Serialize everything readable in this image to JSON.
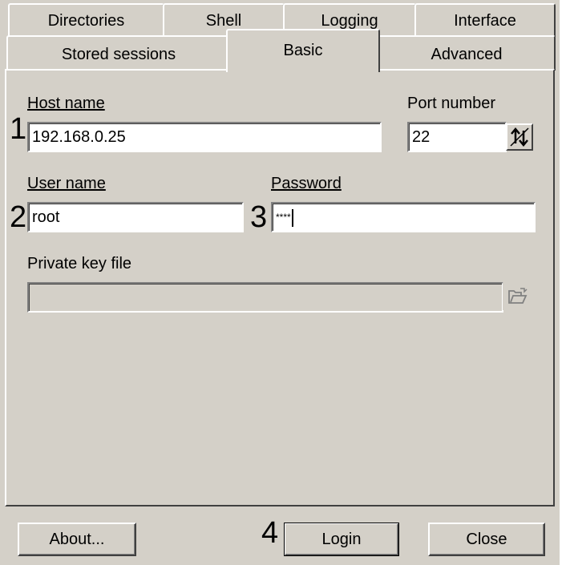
{
  "tabs": {
    "row1": [
      "Directories",
      "Shell",
      "Logging",
      "Interface"
    ],
    "row2": [
      "Stored sessions",
      "Basic",
      "Advanced"
    ],
    "active": "Basic"
  },
  "basic": {
    "host_label": "Host name",
    "host_value": "192.168.0.25",
    "port_label": "Port number",
    "port_value": "22",
    "user_label": "User name",
    "user_value": "root",
    "password_label": "Password",
    "password_value": "****",
    "keyfile_label": "Private key file",
    "keyfile_value": ""
  },
  "markers": [
    "1",
    "2",
    "3",
    "4"
  ],
  "buttons": {
    "about": "About...",
    "login": "Login",
    "close": "Close"
  },
  "icons": {
    "port_spinner": "up-down-arrows-icon",
    "keyfile_browse": "folder-open-icon"
  }
}
